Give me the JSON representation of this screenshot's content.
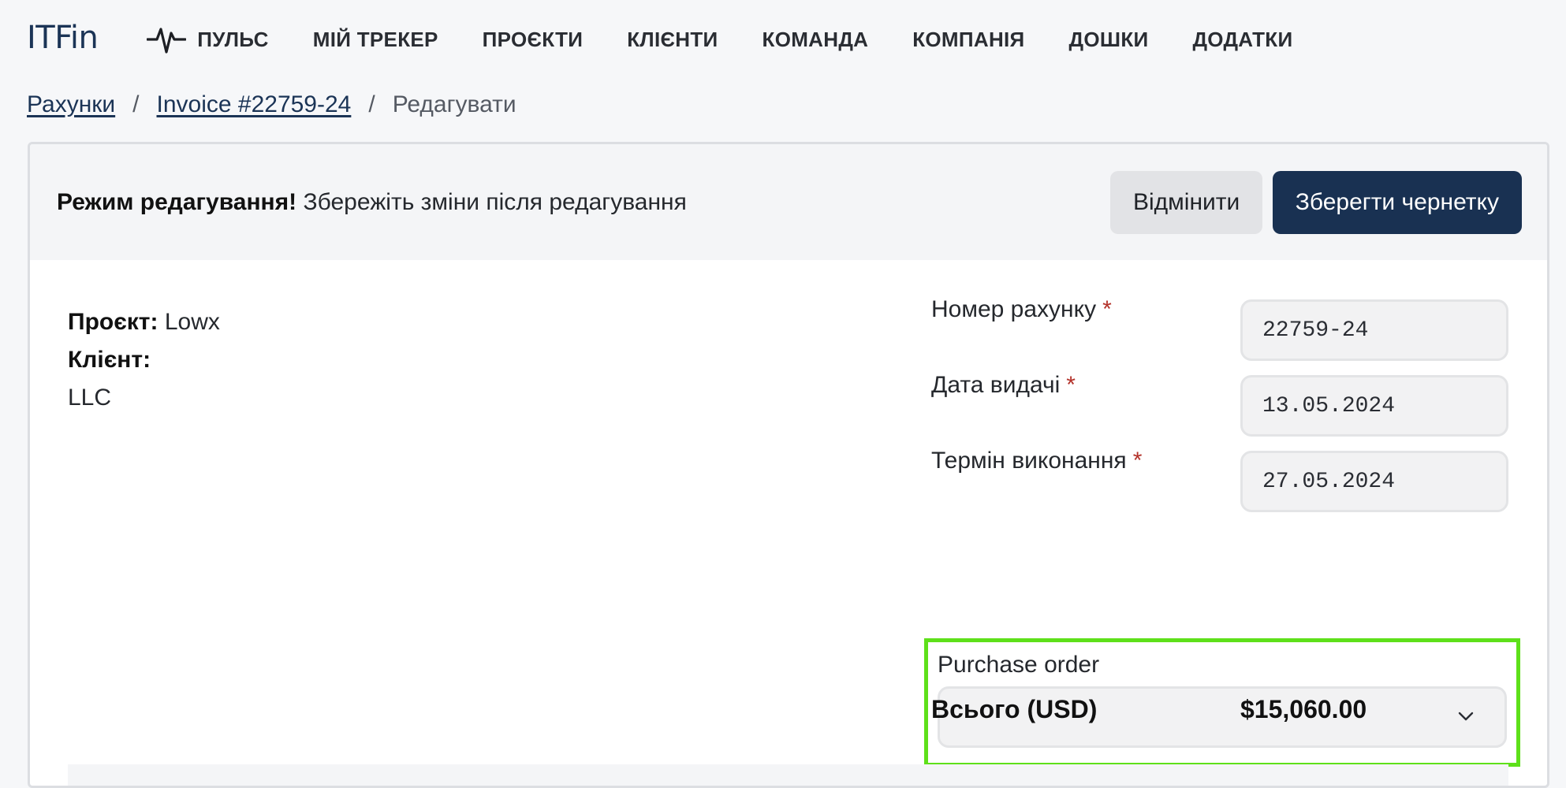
{
  "app": {
    "logo": "ITFin"
  },
  "nav": {
    "items": [
      {
        "label": "ПУЛЬС",
        "icon": "pulse-icon"
      },
      {
        "label": "МІЙ ТРЕКЕР"
      },
      {
        "label": "ПРОЄКТИ"
      },
      {
        "label": "КЛІЄНТИ"
      },
      {
        "label": "КОМАНДА"
      },
      {
        "label": "КОМПАНІЯ"
      },
      {
        "label": "ДОШКИ"
      },
      {
        "label": "ДОДАТКИ"
      }
    ]
  },
  "breadcrumb": {
    "items": [
      "Рахунки",
      "Invoice #22759-24",
      "Редагувати"
    ],
    "separator": "/"
  },
  "edit_bar": {
    "title_bold": "Режим редагування!",
    "message": "Збережіть зміни після редагування",
    "cancel_label": "Відмінити",
    "save_label": "Зберегти чернетку"
  },
  "info": {
    "project_label": "Проєкт:",
    "project_value": "Lowx",
    "client_label": "Клієнт:",
    "client_value": "LLC"
  },
  "form": {
    "required_mark": "*",
    "invoice_number": {
      "label": "Номер рахунку",
      "value": "22759-24"
    },
    "issue_date": {
      "label": "Дата видачі",
      "value": "13.05.2024"
    },
    "due_date": {
      "label": "Термін виконання",
      "value": "27.05.2024"
    },
    "purchase_order": {
      "label": "Purchase order",
      "value": ""
    }
  },
  "total": {
    "label": "Всього (USD)",
    "value": "$15,060.00"
  },
  "colors": {
    "brand": "#193152",
    "highlight": "#5ee01a",
    "required": "#b3322a"
  }
}
